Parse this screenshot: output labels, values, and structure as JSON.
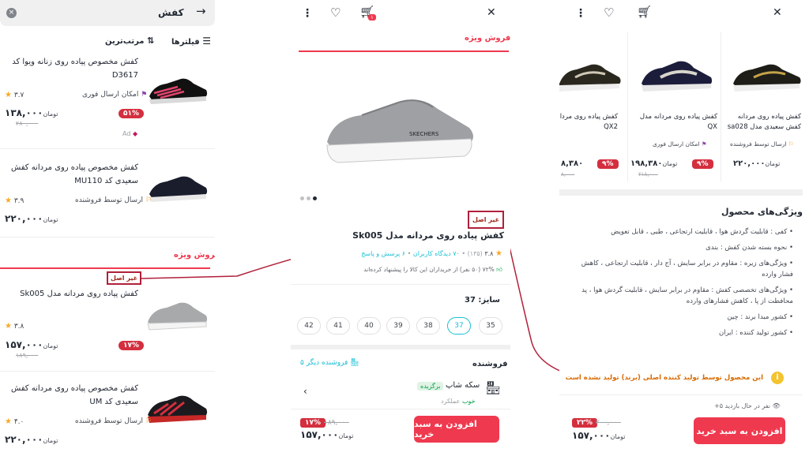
{
  "search": {
    "query": "کفش"
  },
  "toolbar": {
    "filters": "فیلترها",
    "sort": "مرتب‌ترین"
  },
  "list": [
    {
      "title": "کفش مخصوص پیاده روی زنانه ویوا کد D3617",
      "rating": "۳.۷",
      "badge": "امکان ارسال فوری",
      "discount": "۵۱%",
      "price": "۱۳۸,۰۰۰",
      "old_price": "۲۸۰,۰۰۰",
      "ad": "Ad"
    },
    {
      "title": "کفش مخصوص پیاده روی مردانه کفش سعیدی کد MU110",
      "rating": "۳.۹",
      "badge": "ارسال توسط فروشنده",
      "price": "۲۲۰,۰۰۰"
    },
    {
      "title": "کفش پیاده روی مردانه مدل Sk005",
      "rating": "۳.۸",
      "discount": "۱۷%",
      "price": "۱۵۷,۰۰۰",
      "old_price": "۱۸۹,۰۰۰"
    },
    {
      "title": "کفش مخصوص پیاده روی مردانه کفش سعیدی کد UM",
      "rating": "۴.۰",
      "badge": "ارسال توسط فروشنده",
      "price": "۲۲۰,۰۰۰"
    }
  ],
  "special_sale": "فروش ویژه",
  "not_original": "غیر اصل",
  "currency": "تومان",
  "detail": {
    "cart_count": "۱",
    "special_sale": "فروش ویژه",
    "title": "کفش پیاده روی مردانه مدل Sk005",
    "rating": "۳.۸",
    "rating_count": "(۱۳۵)",
    "reviews": "۷۰ دیدگاه کاربران",
    "qa": "۶ پرسش و پاسخ",
    "recommend": "۷۲% (۵۰ نفر) از خریداران این کالا را پیشنهاد کرده‌اند",
    "size_label": "سایز: 37",
    "sizes": [
      "35",
      "37",
      "38",
      "39",
      "40",
      "41",
      "42"
    ],
    "seller_label": "فروشنده",
    "other_sellers": "۵ فروشنده دیگر",
    "seller_name": "سکه شاپ",
    "seller_badge": "برگزیده",
    "seller_performance": "عملکرد",
    "seller_performance_value": "خوب",
    "add_to_cart": "افزودن به سبد خرید",
    "discount": "۱۷%",
    "old_price": "۱۸۹,۰۰۰",
    "price": "۱۵۷,۰۰۰"
  },
  "features_page": {
    "carousel": [
      {
        "title": "کفش پیاده روی مردانه کفش سعیدی مدل sa028",
        "badge": "ارسال توسط فروشنده",
        "price": "۲۲۰,۰۰۰"
      },
      {
        "title": "کفش پیاده روی مردانه مدل QX",
        "badge": "امکان ارسال فوری",
        "discount": "۹%",
        "price": "۱۹۸,۳۸۰",
        "old_price": "۲۱۸,۰۰۰"
      },
      {
        "title": "کفش پیاده روی مردانه مدل QX2",
        "discount": "۹%",
        "price": "۸,۳۸۰",
        "old_price": "۸,۰۰۰"
      }
    ],
    "heading": "ویژگی‌های محصول",
    "features": [
      "کفی : قابلیت گردش هوا ، قابلیت ارتجاعی ، طبی ، قابل تعویض",
      "نحوه بسته شدن کفش : بندی",
      "ویژگی‌های زیره : مقاوم در برابر سایش ، آج دار ، قابلیت ارتجاعی ، کاهش فشار وارده",
      "ویژگی‌های تخصصی کفش : مقاوم در برابر سایش ، قابلیت گردش هوا ، پد محافظت از پا ، کاهش فشارهای وارده",
      "کشور مبدا برند : چین",
      "کشور تولید کننده : ایران"
    ],
    "warning": "این محصول توسط تولید کننده اصلی (برند) تولید نشده است",
    "visitors": "+۵ نفر در حال بازدید",
    "add_to_cart": "افزودن به سبد خرید",
    "discount": "۲۲%",
    "old_price": "۲۰۰,۰۰۰",
    "price": "۱۵۷,۰۰۰"
  },
  "colors": {
    "accent": "#ef394e",
    "annotation": "#b0203a",
    "link": "#19bfd3",
    "star": "#f9a825"
  }
}
